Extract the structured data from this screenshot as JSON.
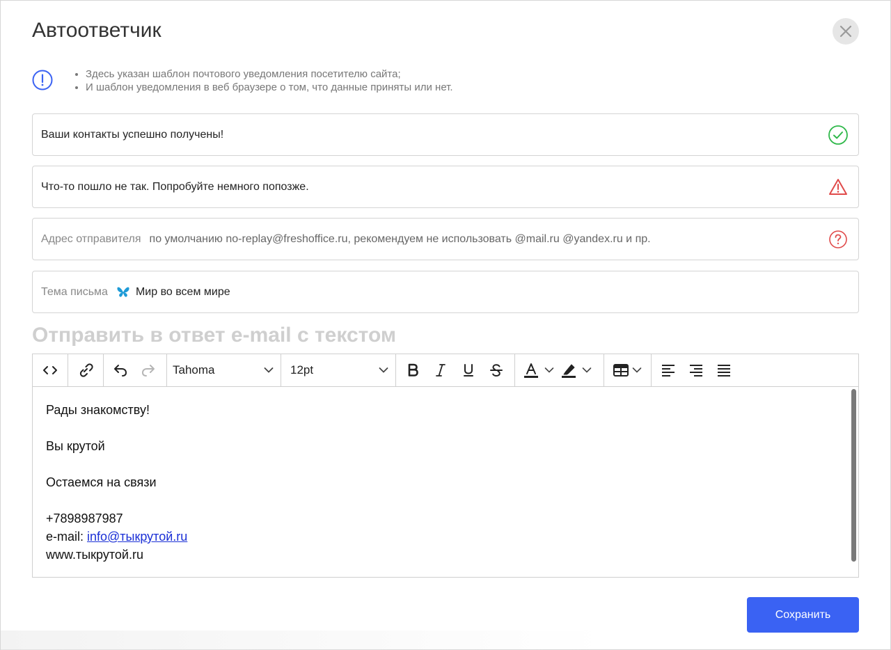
{
  "dialog": {
    "title": "Автоответчик"
  },
  "info": {
    "items": [
      "Здесь указан шаблон почтового уведомления посетителю сайта;",
      "И шаблон уведомления в веб браузере о том, что данные приняты или нет."
    ]
  },
  "fields": {
    "success_message": {
      "value": "Ваши контакты успешно получены!",
      "icon": "check-circle-icon",
      "color": "#2fb84a"
    },
    "error_message": {
      "value": "Что-то пошло не так. Попробуйте немного попозже.",
      "icon": "warning-triangle-icon",
      "color": "#e04a4a"
    },
    "sender_address": {
      "label": "Адрес отправителя",
      "placeholder": "по умолчанию no-replay@freshoffice.ru, рекомендуем не использовать @mail.ru @yandex.ru и пр.",
      "icon": "help-circle-icon",
      "color": "#e04a4a"
    },
    "subject": {
      "label": "Тема письма",
      "value": "Мир во всем мире",
      "icon": "butterfly-icon"
    }
  },
  "section_title": "Отправить в ответ e-mail с текстом",
  "editor": {
    "toolbar": {
      "font_family": "Tahoma",
      "font_size": "12pt"
    },
    "content": {
      "line1": "Рады знакомству!",
      "line2": "Вы крутой",
      "line3": "Остаемся на связи",
      "phone": "+7898987987",
      "email_prefix": "e-mail: ",
      "email_link": "info@тыкрутой.ru",
      "website": "www.тыкрутой.ru"
    }
  },
  "actions": {
    "save_label": "Сохранить"
  },
  "colors": {
    "accent": "#3a62f3",
    "link": "#1a2fd6",
    "section_title": "#cfcfcf"
  }
}
